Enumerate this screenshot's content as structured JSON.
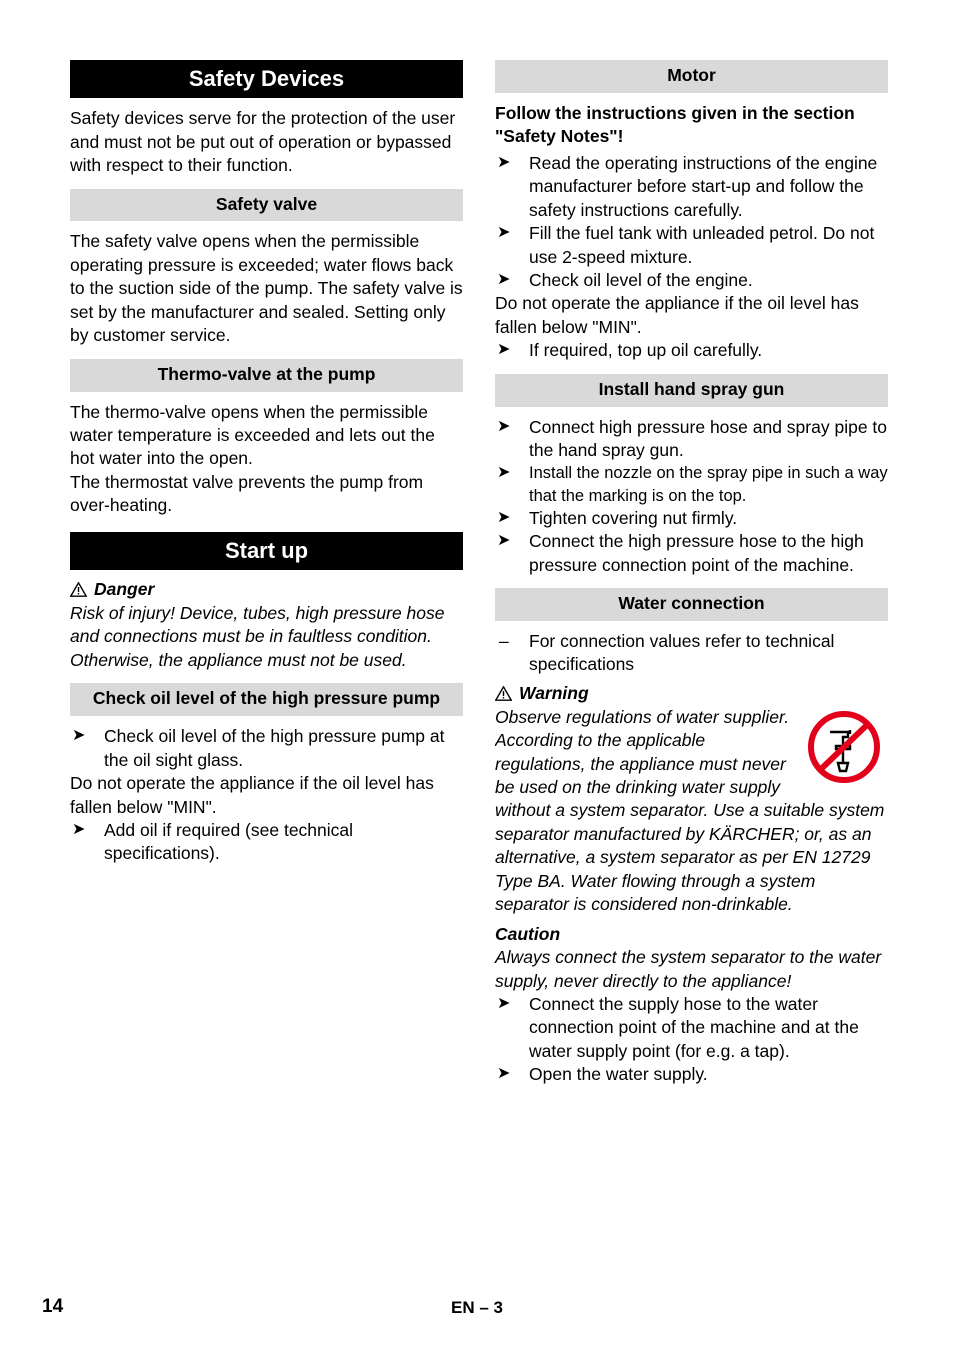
{
  "document": {
    "footer": {
      "page_number": "14",
      "center": "EN – 3"
    }
  },
  "left_column": {
    "safety_devices": {
      "title": "Safety Devices",
      "intro": "Safety devices serve for the protection of the user and must not be put out of operation or bypassed with respect to their function.",
      "safety_valve": {
        "title": "Safety valve",
        "body": "The safety valve opens when the permissible operating pressure is exceeded; water flows back to the suction side of the pump. The safety valve is set by the manufacturer and sealed. Setting only by customer service."
      },
      "thermo_valve": {
        "title": "Thermo-valve at the pump",
        "body_1": "The thermo-valve opens when the permissible water temperature is exceeded and lets out the hot water into the open.",
        "body_2": "The thermostat valve prevents the pump from over-heating."
      }
    },
    "start_up": {
      "title": "Start up",
      "danger_label": "Danger",
      "danger_text": "Risk of injury! Device, tubes, high pressure hose and connections must be in faultless condition. Otherwise, the appliance must not be used.",
      "check_oil": {
        "title": "Check oil level of the high pressure pump",
        "items_1": [
          "Check oil level of the high pressure pump at the oil sight glass."
        ],
        "note": "Do not operate the appliance if the oil level has fallen below \"MIN\".",
        "items_2": [
          "Add oil if required (see technical specifications)."
        ]
      }
    }
  },
  "right_column": {
    "motor": {
      "title": "Motor",
      "lead": "Follow the instructions given in the section \"Safety Notes\"!",
      "items_1": [
        "Read the operating instructions of the engine manufacturer before start-up and follow the safety instructions carefully.",
        "Fill the fuel tank with unleaded petrol. Do not use 2-speed mixture.",
        "Check oil level of the engine."
      ],
      "note": "Do not operate the appliance if the oil level has fallen below \"MIN\".",
      "items_2": [
        "If required, top up oil carefully."
      ]
    },
    "hand_spray_gun": {
      "title": "Install hand spray gun",
      "items": [
        "Connect high pressure hose and spray pipe to the hand spray gun.",
        "Install the nozzle on the spray pipe in such a way that the marking is on the top.",
        "Tighten covering nut firmly.",
        "Connect the high pressure hose to the high pressure connection point of the machine."
      ]
    },
    "water_connection": {
      "title": "Water connection",
      "dash_items": [
        "For connection values refer to technical specifications"
      ],
      "warning_label": "Warning",
      "warning_text": "Observe regulations of water supplier. According to the applicable regulations, the appliance must never be used on the drinking water supply without a system separator. Use a suitable system separator manufactured by KÄRCHER; or, as an alternative, a system separator as per EN 12729 Type BA. Water flowing through a system separator is considered non-drinkable.",
      "caution_label": "Caution",
      "caution_text": "Always connect the system separator to the water supply, never directly to the appliance!",
      "items": [
        "Connect the supply hose to the water connection point of the machine and at the water supply point (for e.g. a tap).",
        "Open the water supply."
      ]
    }
  },
  "icons": {
    "danger_triangle": "warning-triangle-icon",
    "arrow_bullet": "arrow-right-bullet-icon",
    "no_drinking_water": "no-drinking-water-icon"
  },
  "colors": {
    "header_black_bg": "#000000",
    "header_grey_bg": "#d9d9d9",
    "prohibition_red": "#e2001a"
  }
}
